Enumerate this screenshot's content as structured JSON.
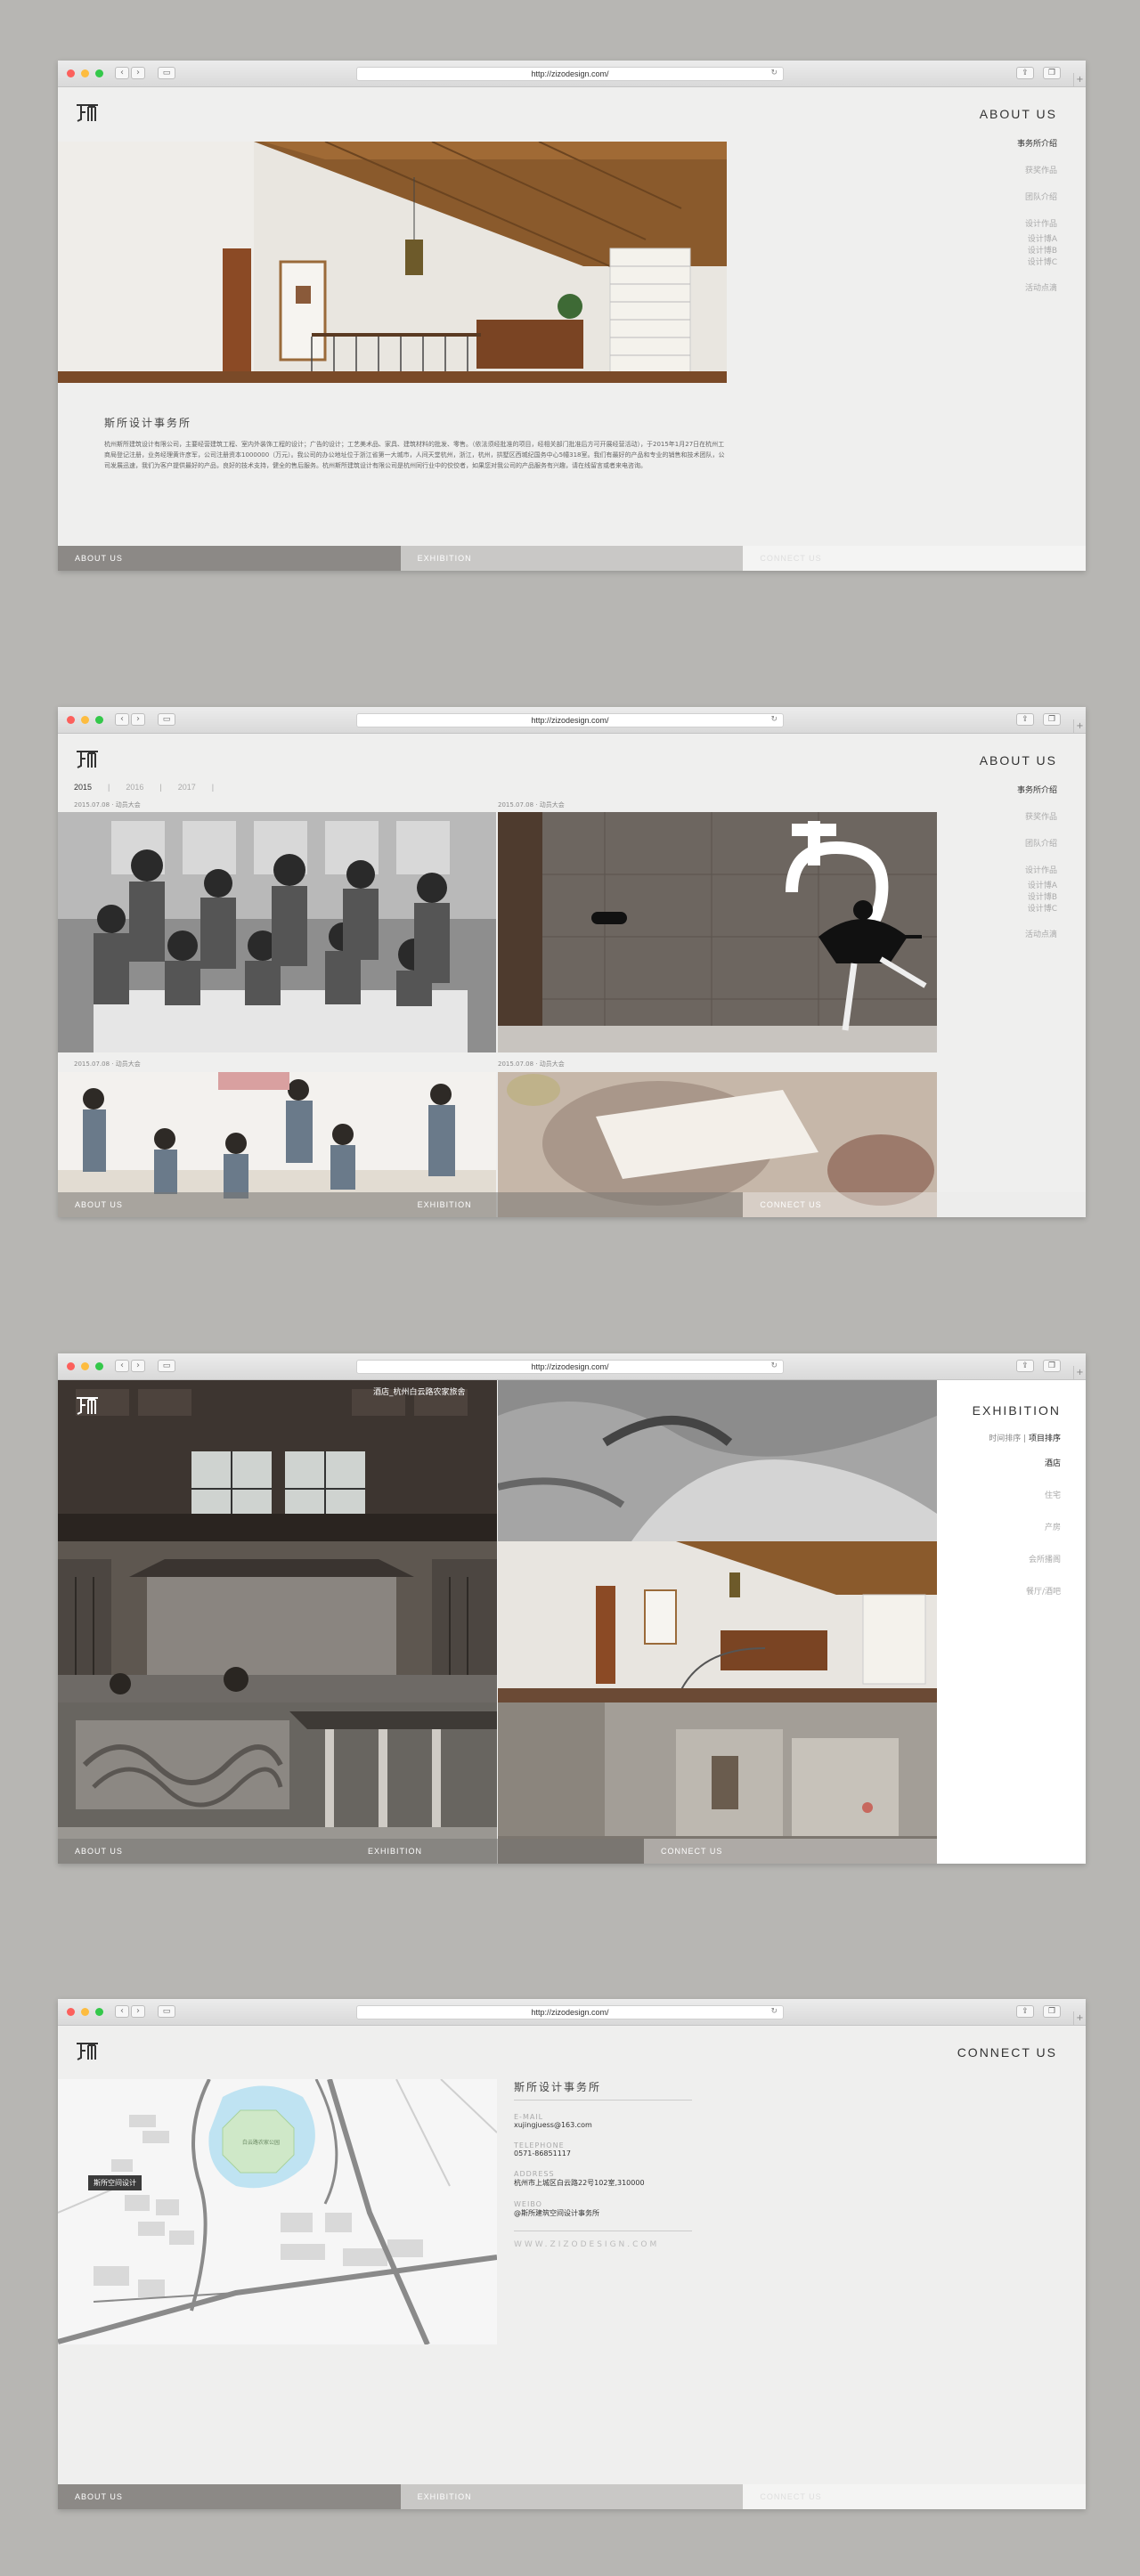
{
  "browser": {
    "url": "http://zizodesign.com/",
    "dot_colors": [
      "#fc605c",
      "#fdbc40",
      "#34c84a"
    ]
  },
  "nav": {
    "items": [
      "事务所介绍",
      "获奖作品",
      "团队介绍",
      "设计作品",
      "活动点滴"
    ],
    "design_sub": [
      "设计博A",
      "设计博B",
      "设计博C"
    ]
  },
  "bottom": {
    "about": "ABOUT US",
    "exhibition": "EXHIBITION",
    "connect": "CONNECT US"
  },
  "about": {
    "title": "ABOUT US",
    "company": "斯所设计事务所",
    "body": "杭州斯所建筑设计有限公司，主要经营建筑工程、室内外装饰工程的设计；广告的设计；工艺美术品、家具、建筑材料的批发、零售。（依法须经批准的项目，经相关部门批准后方可开展经营活动），于2015年1月27日在杭州工商局登记注册，业务经理黄许彦军，公司注册资本1000000（万元）。我公司的办公地址位于浙江省第一大城市，人间天堂杭州，浙江，杭州，拱墅区西城纪国务中心5幢318室。我们有最好的产品和专业的销售和技术团队，公司发展迅速，我们为客户提供最好的产品，良好的技术支持，健全的售后服务。杭州斯所建筑设计有限公司是杭州同行业中的佼佼者，如果您对我公司的产品服务有兴趣，请在线留言或者来电咨询。"
  },
  "activity": {
    "title": "ABOUT US",
    "years": [
      "2015",
      "2016",
      "2017"
    ],
    "captions": [
      "2015.07.08  · 动员大会",
      "2015.07.08  · 动员大会",
      "2015.07.08  · 动员大会",
      "2015.07.08  · 动员大会"
    ]
  },
  "exhibition": {
    "title": "EXHIBITION",
    "sort_prefix": "时间排序",
    "sort_active": "项目排序",
    "categories": [
      "酒店",
      "住宅",
      "产房",
      "会所播阁",
      "餐厅/酒吧"
    ],
    "photo_caption": "酒店_杭州白云路农家旅舍"
  },
  "contact": {
    "title": "CONNECT US",
    "company": "斯所设计事务所",
    "email_label": "E-MAIL",
    "email": "xujingjuess@163.com",
    "phone_label": "TELEPHONE",
    "phone": "0571-86851117",
    "address_label": "ADDRESS",
    "address": "杭州市上城区白云路22号102室,310000",
    "weibo_label": "WEIBO",
    "weibo": "@斯所建筑空间设计事务所",
    "website": "WWW.ZIZODESIGN.COM",
    "map_label": "斯所空间设计"
  }
}
